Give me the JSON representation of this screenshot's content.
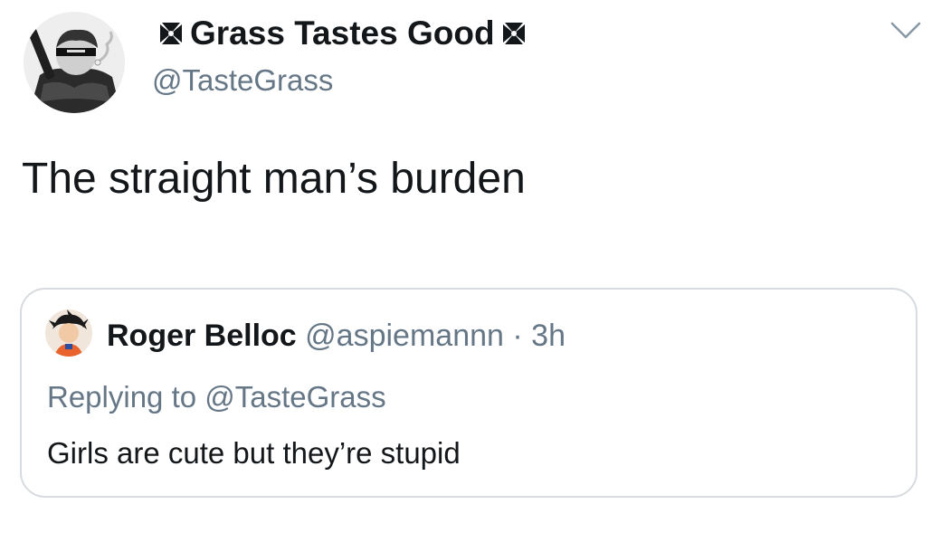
{
  "tweet": {
    "author": {
      "display_name": "Grass Tastes Good",
      "name_icon": "maltese-cross-icon",
      "handle": "@TasteGrass",
      "avatar_icon": "avatar-image"
    },
    "menu_icon": "chevron-down-icon",
    "text": "The straight man’s burden"
  },
  "quoted_tweet": {
    "author": {
      "display_name": "Roger Belloc",
      "handle": "@aspiemannn",
      "separator": "·",
      "time": "3h",
      "avatar_icon": "avatar-image"
    },
    "replying_to": "Replying to @TasteGrass",
    "text": "Girls are cute but they’re stupid"
  },
  "colors": {
    "text_primary": "#14171a",
    "text_secondary": "#657786",
    "border": "#d7dbdf"
  }
}
